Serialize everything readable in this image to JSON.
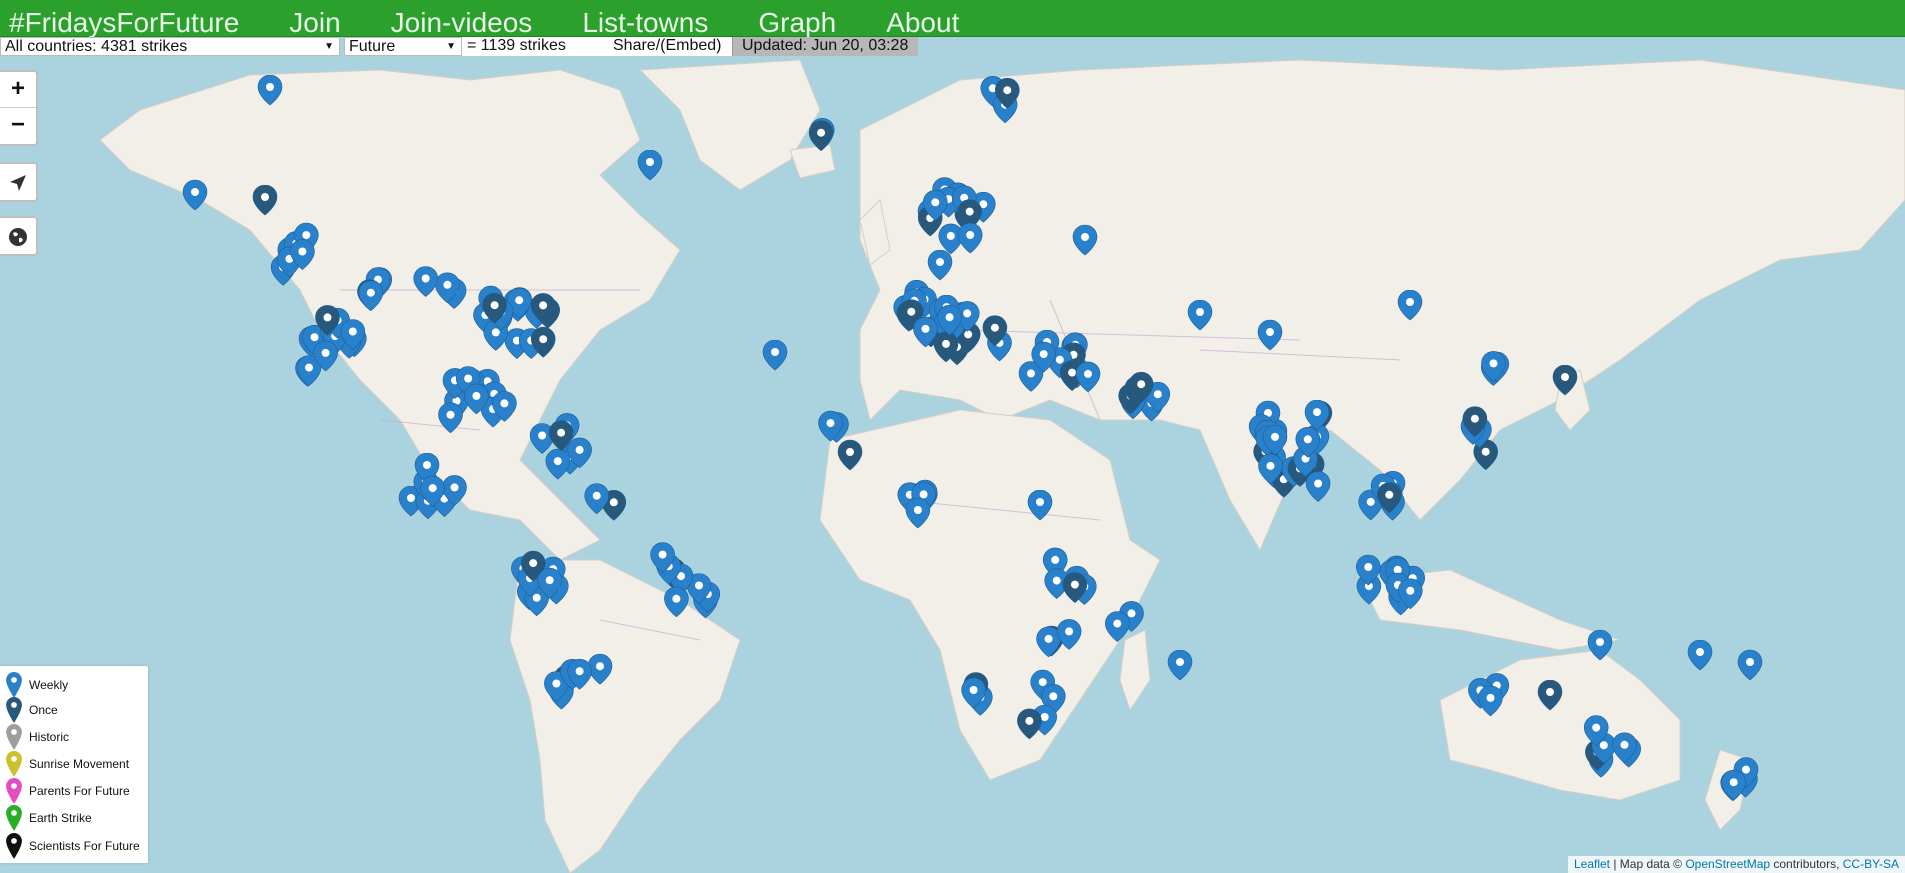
{
  "nav": {
    "brand": "#FridaysForFuture",
    "items": [
      "Join",
      "Join-videos",
      "List-towns",
      "Graph",
      "About"
    ]
  },
  "controls": {
    "country_filter": "All countries: 4381 strikes",
    "time_filter": "Future",
    "strike_count": "= 1139 strikes",
    "share_label": "Share/(Embed)",
    "updated": "Updated: Jun 20, 03:28"
  },
  "map_controls": {
    "zoom_in": "+",
    "zoom_out": "−"
  },
  "legend": [
    {
      "label": "Weekly",
      "color": "#2a81cb"
    },
    {
      "label": "Once",
      "color": "#28587b"
    },
    {
      "label": "Historic",
      "color": "#9e9e9e"
    },
    {
      "label": "Sunrise Movement",
      "color": "#cbc12a"
    },
    {
      "label": "Parents For Future",
      "color": "#e34fc1"
    },
    {
      "label": "Earth Strike",
      "color": "#2aad27"
    },
    {
      "label": "Scientists For Future",
      "color": "#111111"
    }
  ],
  "attribution": {
    "leaflet": "Leaflet",
    "sep": " | Map data © ",
    "osm": "OpenStreetMap",
    "contrib": " contributors, ",
    "license": "CC-BY-SA"
  },
  "colors": {
    "nav_bg": "#2ca02c",
    "water": "#aad3df",
    "land": "#f2efe9",
    "weekly": "#2a81cb",
    "once": "#28587b"
  }
}
